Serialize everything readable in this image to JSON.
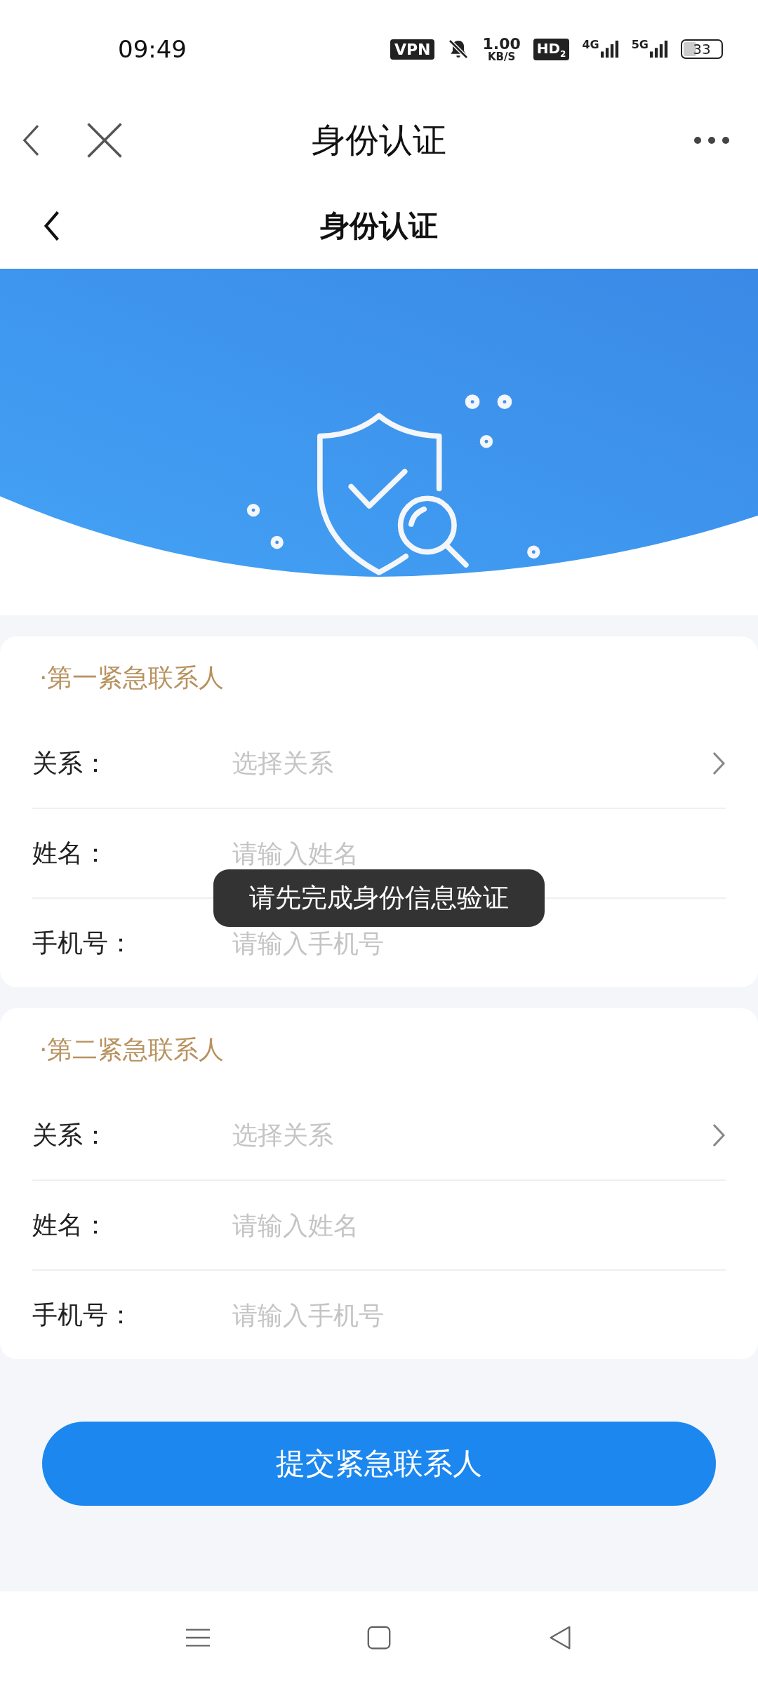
{
  "status_bar": {
    "time": "09:49",
    "vpn": "VPN",
    "speed": "1.00",
    "speed_unit": "KB/S",
    "hd": "HD$_{2}$",
    "networks": [
      "4G",
      "5G"
    ],
    "battery": "33"
  },
  "browser_bar": {
    "title": "身份认证"
  },
  "page_header": {
    "title": "身份认证"
  },
  "sections": [
    {
      "title": "·第一紧急联系人",
      "fields": [
        {
          "kind": "select",
          "label": "关系：",
          "placeholder": "选择关系"
        },
        {
          "kind": "input",
          "label": "姓名：",
          "placeholder": "请输入姓名"
        },
        {
          "kind": "input",
          "label": "手机号：",
          "placeholder": "请输入手机号"
        }
      ]
    },
    {
      "title": "·第二紧急联系人",
      "fields": [
        {
          "kind": "select",
          "label": "关系：",
          "placeholder": "选择关系"
        },
        {
          "kind": "input",
          "label": "姓名：",
          "placeholder": "请输入姓名"
        },
        {
          "kind": "input",
          "label": "手机号：",
          "placeholder": "请输入手机号"
        }
      ]
    }
  ],
  "toast": "请先完成身份信息验证",
  "submit_button": "提交紧急联系人"
}
